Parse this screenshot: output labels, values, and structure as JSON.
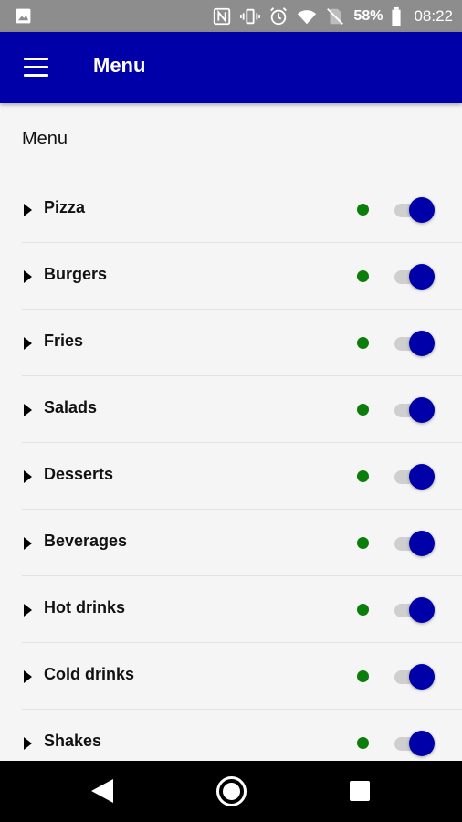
{
  "status_bar": {
    "icons_left": [
      "image-icon"
    ],
    "icons_right": [
      "nfc-icon",
      "vibrate-icon",
      "alarm-icon",
      "wifi-icon",
      "no-sim-icon"
    ],
    "battery": "58%",
    "time": "08:22"
  },
  "app_bar": {
    "title": "Menu",
    "menu_icon": "hamburger-icon",
    "color": "#0000a9"
  },
  "content": {
    "section_title": "Menu",
    "items": [
      {
        "label": "Pizza",
        "status_color": "#0a7d0a",
        "enabled": true
      },
      {
        "label": "Burgers",
        "status_color": "#0a7d0a",
        "enabled": true
      },
      {
        "label": "Fries",
        "status_color": "#0a7d0a",
        "enabled": true
      },
      {
        "label": "Salads",
        "status_color": "#0a7d0a",
        "enabled": true
      },
      {
        "label": "Desserts",
        "status_color": "#0a7d0a",
        "enabled": true
      },
      {
        "label": "Beverages",
        "status_color": "#0a7d0a",
        "enabled": true
      },
      {
        "label": "Hot drinks",
        "status_color": "#0a7d0a",
        "enabled": true
      },
      {
        "label": "Cold drinks",
        "status_color": "#0a7d0a",
        "enabled": true
      },
      {
        "label": "Shakes",
        "status_color": "#0a7d0a",
        "enabled": true
      }
    ]
  },
  "nav_bar": {
    "icons": [
      "back-icon",
      "home-icon",
      "recents-icon"
    ]
  }
}
